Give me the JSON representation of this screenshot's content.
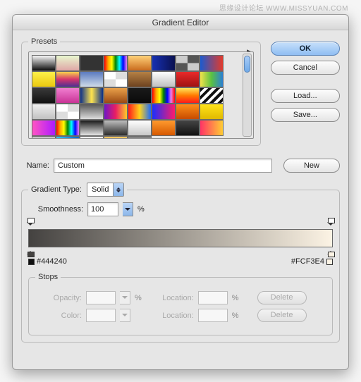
{
  "watermark": "思缘设计论坛  WWW.MISSYUAN.COM",
  "window": {
    "title": "Gradient Editor"
  },
  "presets": {
    "legend": "Presets",
    "swatches": [
      "linear-gradient(#f8f8f8,#0c0c0c)",
      "linear-gradient(#e8f7cf,#dfa6a6)",
      "linear-gradient(#333,#333)",
      "linear-gradient(90deg,red,orange,yellow,green,cyan,blue,violet)",
      "linear-gradient(#ffd27a,#c96b1d)",
      "linear-gradient(90deg,#1730b3,#0a1150)",
      "conic-gradient(#555 25%,#ccc 0 50%,#555 0 75%,#ccc 0)",
      "linear-gradient(90deg,#1b5ad0,#e33a2b)",
      "linear-gradient(#fff04a,#eac90f)",
      "linear-gradient(#f6d24c,#d6356c,#4e2f93)",
      "linear-gradient(#5b7abf,#cedbe8)",
      "repeating-conic-gradient(#ddd 0 25%,#fff 0 50%)",
      "linear-gradient(#b58044,#6e4320)",
      "linear-gradient(#fff,#bfbfbf)",
      "linear-gradient(#ea2a2a,#9f1212)",
      "linear-gradient(90deg,#f3e24a,#59c142,#2a7fd4)",
      "linear-gradient(#3a3a3a,#111)",
      "linear-gradient(#f07ed0,#c93396)",
      "linear-gradient(90deg,#0b2f89,#ffe44d,#0b2f89)",
      "linear-gradient(#e9a14a,#9b4a13)",
      "linear-gradient(#1a1a1a,#0a0a0a)",
      "linear-gradient(90deg,red,orange,yellow,green,blue,violet,red)",
      "linear-gradient(#ffe65c,#ff7a00,#ff1a1a)",
      "repeating-linear-gradient(135deg,#111 0 4px,#fff 4px 8px)",
      "linear-gradient(#efefef,#c1c1c1)",
      "repeating-conic-gradient(#ddd 0 25%,#fff 0 50%)",
      "linear-gradient(#585858,#dddddd)",
      "linear-gradient(90deg,#7014c7,#e91e63,#ffca28)",
      "linear-gradient(90deg,#ff1a1a,#ffd21a,#1a6bff)",
      "linear-gradient(90deg,#1a2fff,#ff1a6b)",
      "linear-gradient(#ff8f1a,#c74a00)",
      "linear-gradient(#ffe31a,#e0b900)",
      "linear-gradient(90deg,#ff55c3,#ad1aff)",
      "linear-gradient(90deg,red,orange,yellow,green,cyan,blue,violet)",
      "linear-gradient(#1a1a1a,#e6e6e6)",
      "linear-gradient(#bdbdbd,#2b2b2b)",
      "linear-gradient(#fff,#c7c7c7)",
      "linear-gradient(#ff9a2e,#d65800)",
      "linear-gradient(#444,#111)",
      "linear-gradient(90deg,#ff3366,#ffcc33)",
      "linear-gradient(#ccc,#777)",
      "linear-gradient(90deg,#33ccff,#0066cc)",
      "linear-gradient(#f0f0f0,#cfcfcf)",
      "linear-gradient(#ffcc66,#cc6600)",
      "linear-gradient(#888,#222)"
    ]
  },
  "buttons": {
    "ok": "OK",
    "cancel": "Cancel",
    "load": "Load...",
    "save": "Save...",
    "new": "New",
    "delete": "Delete"
  },
  "name": {
    "label": "Name:",
    "value": "Custom"
  },
  "gradientType": {
    "legend": "Gradient Type:",
    "value": "Solid"
  },
  "smoothness": {
    "label": "Smoothness:",
    "value": "100",
    "unit": "%"
  },
  "colors": {
    "left": "#444240",
    "right": "#FCF3E4"
  },
  "stops": {
    "legend": "Stops",
    "opacity": "Opacity:",
    "color": "Color:",
    "location": "Location:",
    "unit": "%"
  }
}
